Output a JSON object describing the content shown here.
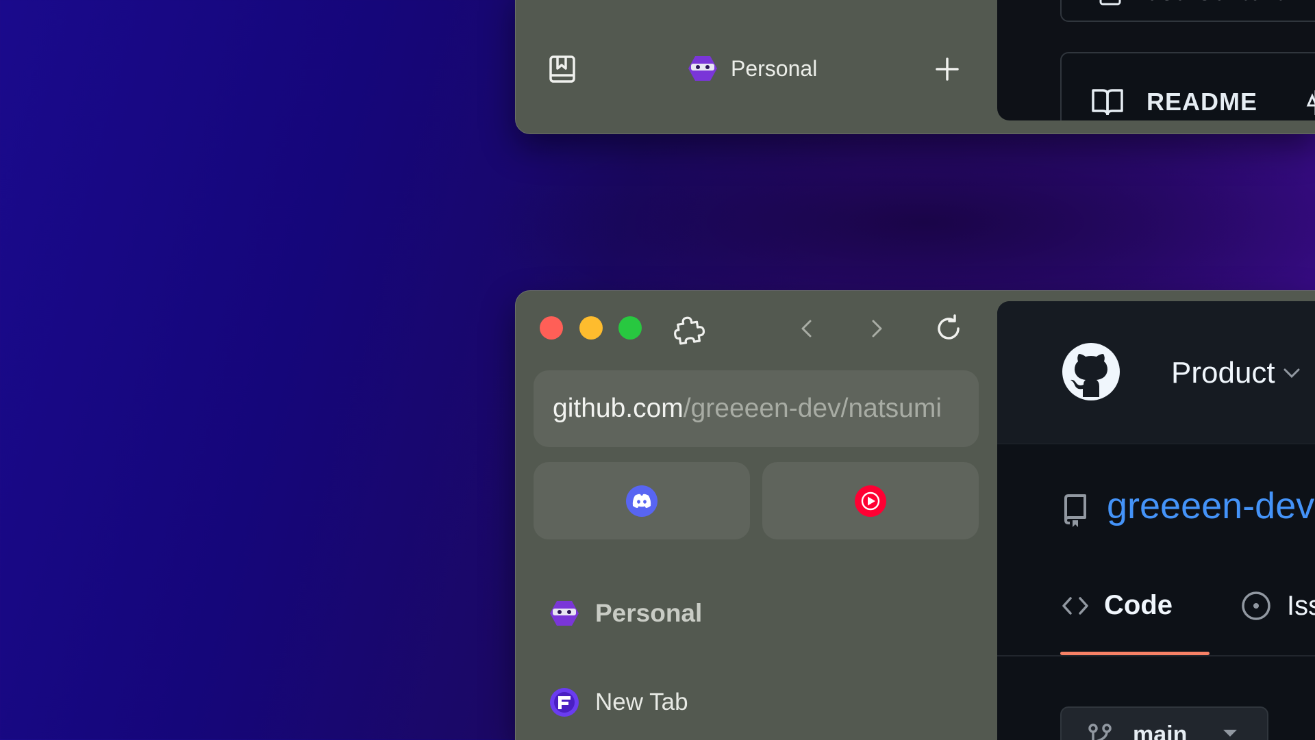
{
  "colors": {
    "accent_tab_underline": "#f78166",
    "repo_link": "#4493f8",
    "sidebar_bg": "#535950",
    "github_bg": "#0d1117"
  },
  "top_window": {
    "space_label": "Personal",
    "content": {
      "file_label": "userContent.",
      "readme_label": "README"
    }
  },
  "bottom_window": {
    "url": {
      "host": "github.com",
      "path": "/greeeen-dev/natsumi"
    },
    "pinned": [
      {
        "name": "Discord",
        "icon": "discord-icon"
      },
      {
        "name": "YouTube Music",
        "icon": "youtube-music-icon"
      }
    ],
    "sidebar": {
      "space_label": "Personal",
      "tab_label": "New Tab"
    },
    "github": {
      "product_label": "Product",
      "repo_name": "greeeen-dev",
      "tabs": {
        "code": "Code",
        "issues": "Iss"
      },
      "branch": "main"
    }
  }
}
